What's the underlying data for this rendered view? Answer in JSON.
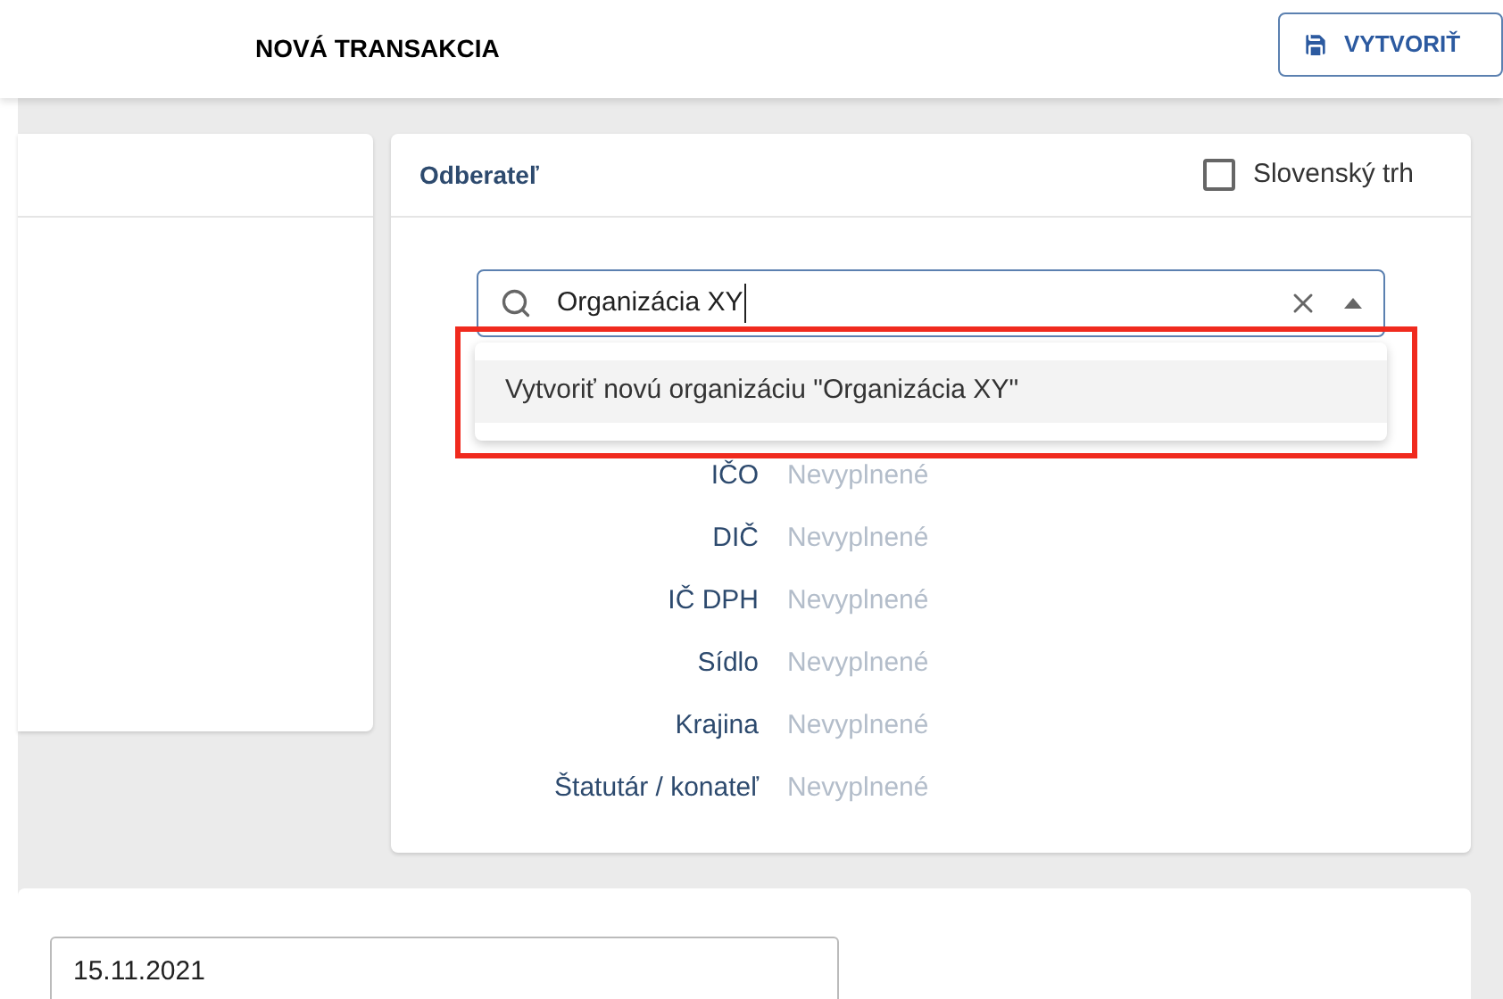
{
  "header": {
    "title": "NOVÁ TRANSAKCIA",
    "create_button": "VYTVORIŤ"
  },
  "customer": {
    "title": "Odberateľ",
    "slovak_market": {
      "label": "Slovenský trh",
      "checked": false
    },
    "search": {
      "value": "Organizácia XY",
      "expanded": true
    },
    "dropdown": {
      "options": [
        {
          "label": "Vytvoriť novú organizáciu \"Organizácia XY\"",
          "selected": true
        }
      ]
    },
    "fields": [
      {
        "label": "IČO",
        "value": "Nevyplnené"
      },
      {
        "label": "DIČ",
        "value": "Nevyplnené"
      },
      {
        "label": "IČ DPH",
        "value": "Nevyplnené"
      },
      {
        "label": "Sídlo",
        "value": "Nevyplnené"
      },
      {
        "label": "Krajina",
        "value": "Nevyplnené"
      },
      {
        "label": "Štatutár / konateľ",
        "value": "Nevyplnené"
      }
    ]
  },
  "date": {
    "value": "15.11.2021"
  }
}
